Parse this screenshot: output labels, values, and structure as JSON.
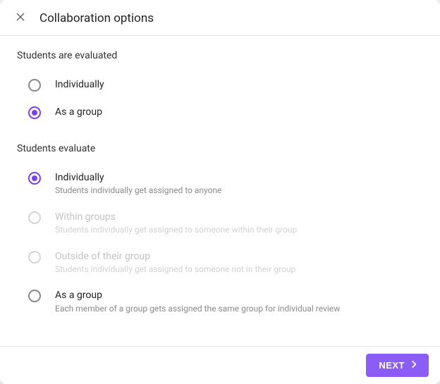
{
  "header": {
    "title": "Collaboration options"
  },
  "section1": {
    "label": "Students are evaluated",
    "options": [
      {
        "label": "Individually",
        "selected": false,
        "disabled": false
      },
      {
        "label": "As a group",
        "selected": true,
        "disabled": false
      }
    ]
  },
  "section2": {
    "label": "Students evaluate",
    "options": [
      {
        "label": "Individually",
        "sub": "Students individually get assigned to anyone",
        "selected": true,
        "disabled": false
      },
      {
        "label": "Within groups",
        "sub": "Students individually get assigned to someone within their group",
        "selected": false,
        "disabled": true
      },
      {
        "label": "Outside of their group",
        "sub": "Students individually get assigned to someone not in their group",
        "selected": false,
        "disabled": true
      },
      {
        "label": "As a group",
        "sub": "Each member of a group gets assigned the same group for individual review",
        "selected": false,
        "disabled": false
      }
    ]
  },
  "footer": {
    "next_label": "NEXT"
  },
  "colors": {
    "accent": "#8b5cf6"
  }
}
